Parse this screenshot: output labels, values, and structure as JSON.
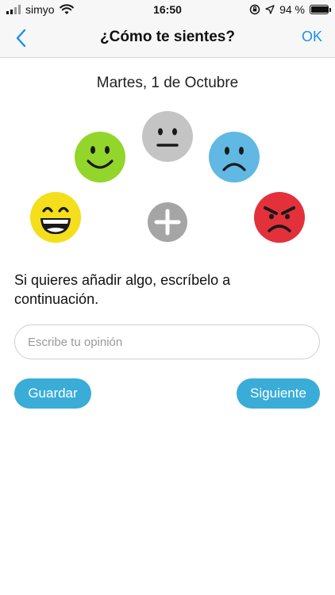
{
  "status_bar": {
    "carrier": "simyo",
    "time": "16:50",
    "battery_text": "94 %"
  },
  "nav": {
    "title": "¿Cómo te sientes?",
    "ok_label": "OK",
    "accent_color": "#1a8ef0"
  },
  "date": "Martes, 1 de Octubre",
  "moods": [
    {
      "icon": "laughing-face-icon",
      "color": "#f5de1b"
    },
    {
      "icon": "smiling-face-icon",
      "color": "#93d62b"
    },
    {
      "icon": "neutral-face-icon",
      "color": "#c4c4c4"
    },
    {
      "icon": "sad-face-icon",
      "color": "#60b8e3"
    },
    {
      "icon": "angry-face-icon",
      "color": "#e3313c"
    },
    {
      "icon": "plus-icon",
      "color": "#a5a5a5"
    }
  ],
  "prompt": "Si quieres añadir algo, escríbelo a continuación.",
  "opinion_input": {
    "value": "",
    "placeholder": "Escribe tu opinión"
  },
  "buttons": {
    "save_label": "Guardar",
    "next_label": "Siguiente",
    "color": "#3aacd8"
  }
}
